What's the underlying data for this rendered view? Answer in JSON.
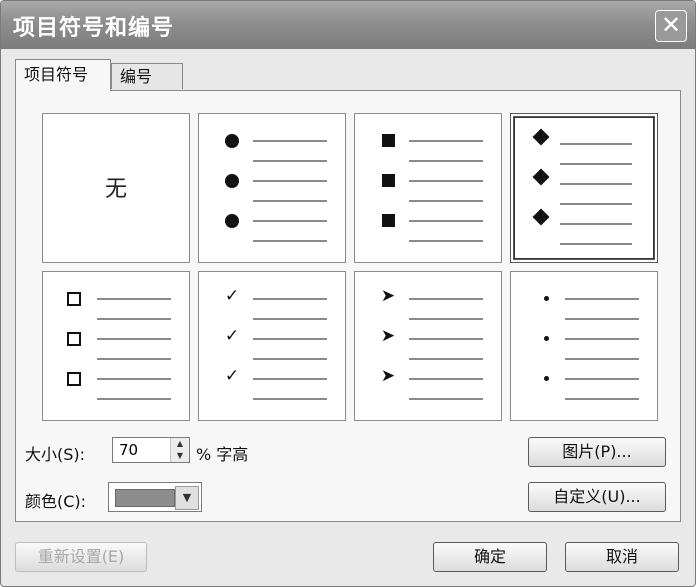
{
  "window": {
    "title": "项目符号和编号",
    "close_label": "✕"
  },
  "tabs": [
    {
      "label": "项目符号"
    },
    {
      "label": "编号"
    }
  ],
  "bullets": {
    "none_label": "无"
  },
  "size": {
    "label": "大小(S):",
    "value": "70",
    "unit": "% 字高"
  },
  "color": {
    "label": "颜色(C):",
    "swatch": "#8d8d8d"
  },
  "buttons": {
    "picture": "图片(P)...",
    "customize": "自定义(U)...",
    "reset": "重新设置(E)",
    "ok": "确定",
    "cancel": "取消"
  }
}
